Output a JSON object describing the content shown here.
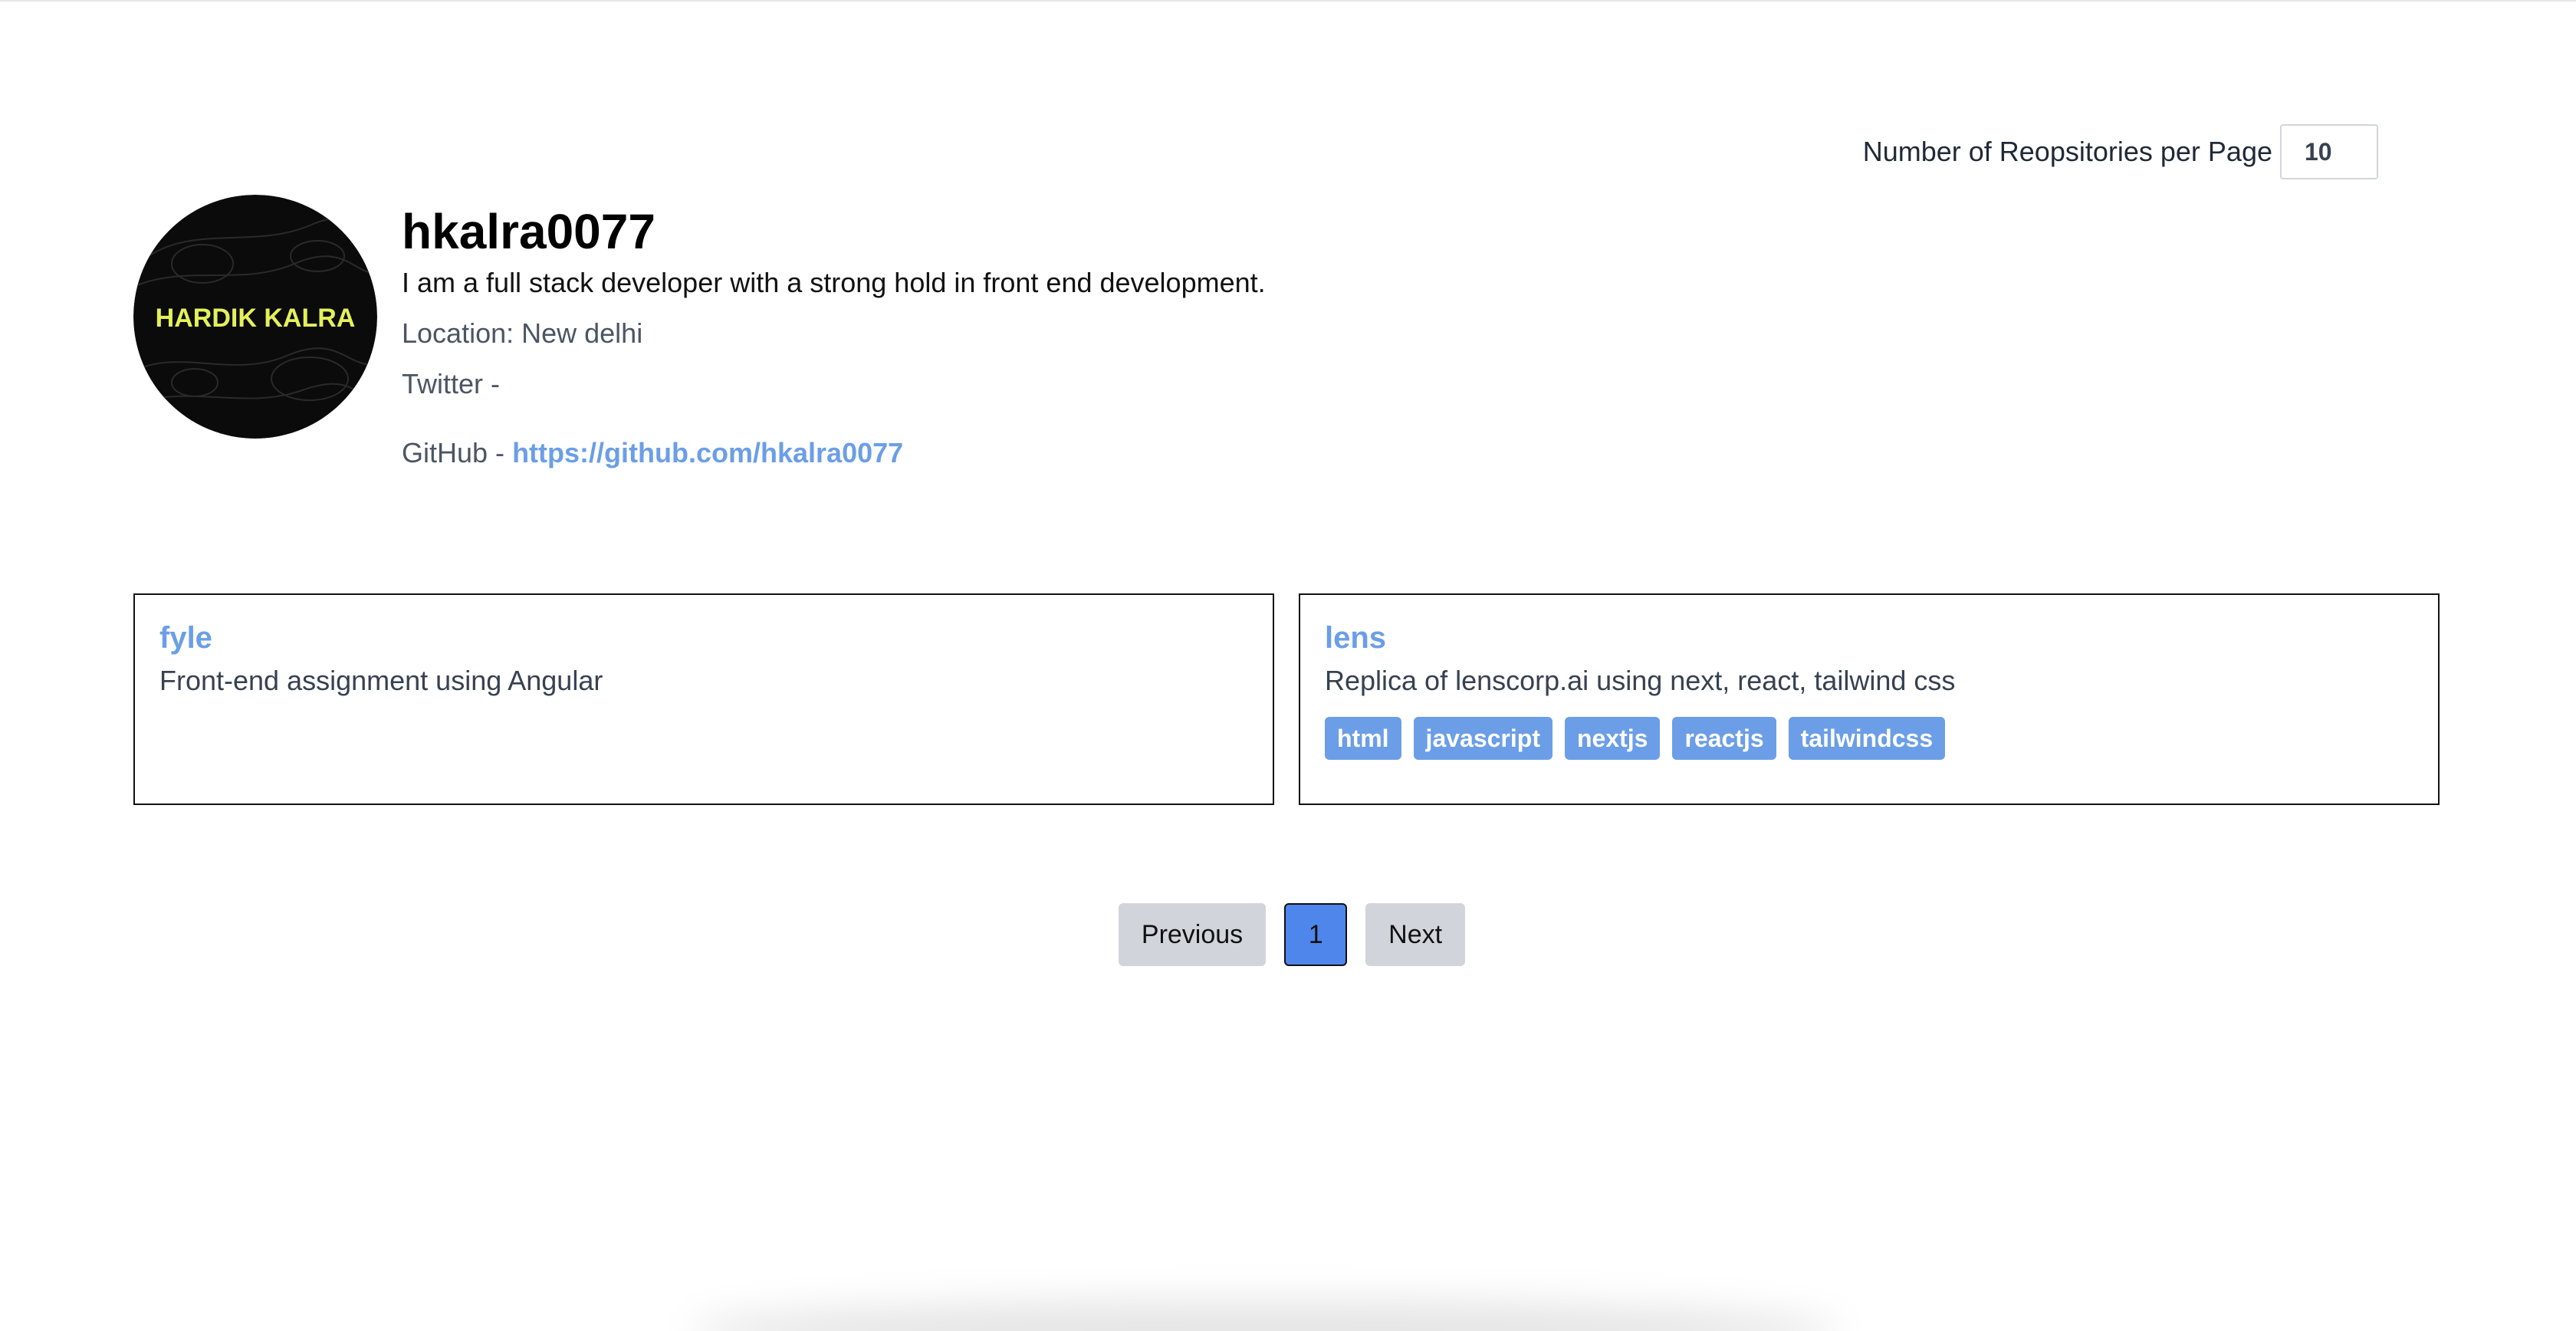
{
  "per_page": {
    "label": "Number of Reopsitories per Page",
    "value": "10"
  },
  "profile": {
    "avatar_text": "HARDIK KALRA",
    "username": "hkalra0077",
    "bio": "I am a full stack developer with a strong hold in front end development.",
    "location": "Location: New delhi",
    "twitter": "Twitter -",
    "github_prefix": "GitHub -",
    "github_url": "https://github.com/hkalra0077"
  },
  "repos": [
    {
      "name": "fyle",
      "description": "Front-end assignment using Angular",
      "topics": []
    },
    {
      "name": "lens",
      "description": "Replica of lenscorp.ai using next, react, tailwind css",
      "topics": [
        "html",
        "javascript",
        "nextjs",
        "reactjs",
        "tailwindcss"
      ]
    }
  ],
  "pagination": {
    "previous": "Previous",
    "current": "1",
    "next": "Next"
  },
  "colors": {
    "link": "#6b9ee7",
    "active_page": "#4f86ec",
    "button_gray": "#d1d5db"
  }
}
